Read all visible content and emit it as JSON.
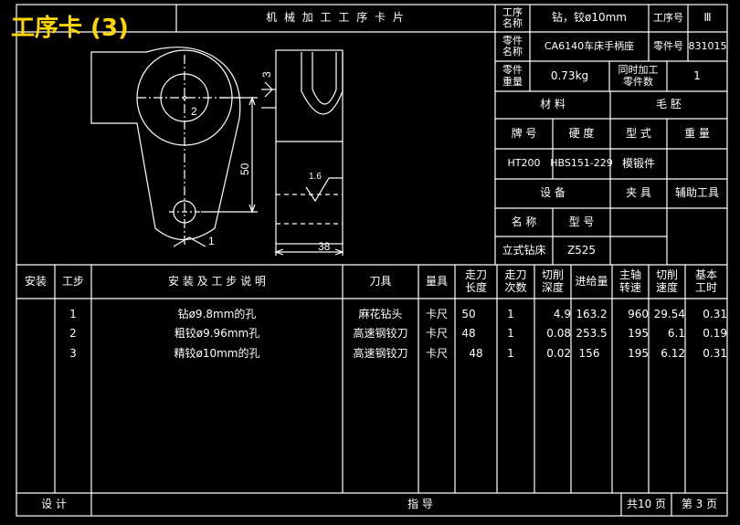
{
  "page_title": "工序卡 (3)",
  "card_title": "机 械 加 工 工 序 卡 片",
  "header": {
    "process_name_label": "工序\n名称",
    "process_name": "钻，铰ø10mm",
    "process_no_label": "工序号",
    "process_no": "Ⅲ",
    "part_name_label": "零件\n名称",
    "part_name": "CA6140车床手柄座",
    "part_no_label": "零件号",
    "part_no": "831015",
    "part_weight_label": "零件\n重量",
    "part_weight": "0.73kg",
    "simul_label": "同时加工\n零件数",
    "simul_count": "1"
  },
  "material": {
    "material_label": "材    料",
    "blank_label": "毛    胚",
    "grade_label": "牌 号",
    "hardness_label": "硬 度",
    "type_label": "型 式",
    "weight_label": "重 量",
    "grade": "HT200",
    "hardness": "HBS151-229",
    "blank_type": "模锻件",
    "blank_weight": ""
  },
  "equipment": {
    "equipment_label": "设    备",
    "fixture_label": "夹  具",
    "fixture": "辅助工具",
    "name_label": "名  称",
    "model_label": "型  号",
    "name": "立式钻床",
    "model": "Z525"
  },
  "drawing": {
    "dim_3": "3",
    "dim_2": "2",
    "dim_50": "50",
    "dim_1": "1",
    "dim_38": "38",
    "roughness": "1.6"
  },
  "table": {
    "headers": [
      "安装",
      "工步",
      "安  装  及  工  步  说  明",
      "刀具",
      "量具",
      "走刀\n长度",
      "走刀\n次数",
      "切削\n深度",
      "进给量",
      "主轴\n转速",
      "切削\n速度",
      "基本\n工时"
    ],
    "rows": [
      {
        "step": "1",
        "desc": "钻ø9.8mm的孔",
        "tool": "麻花钻头",
        "gauge": "卡尺",
        "length": "50",
        "passes": "1",
        "depth": "4.9",
        "feed": "163.2",
        "speed": "960",
        "cut_speed": "29.54",
        "time": "0.31"
      },
      {
        "step": "2",
        "desc": "粗铰ø9.96mm孔",
        "tool": "高速钢铰刀",
        "gauge": "卡尺",
        "length": "48",
        "passes": "1",
        "depth": "0.08",
        "feed": "253.5",
        "speed": "195",
        "cut_speed": "6.1",
        "time": "0.19"
      },
      {
        "step": "3",
        "desc": "精铰ø10mm的孔",
        "tool": "高速钢铰刀",
        "gauge": "卡尺",
        "length": "48",
        "passes": "1",
        "depth": "0.02",
        "feed": "156",
        "speed": "195",
        "cut_speed": "6.12",
        "time": "0.31"
      }
    ]
  },
  "footer": {
    "design_label": "设    计",
    "guide_label": "指    导",
    "total_pages": "共10 页",
    "page_no": "第 3 页"
  }
}
